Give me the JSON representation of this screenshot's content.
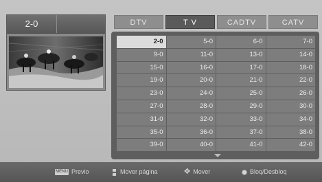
{
  "current_channel": "2-0",
  "tabs": [
    {
      "label": "DTV",
      "active": false
    },
    {
      "label": "T V",
      "active": true
    },
    {
      "label": "CADTV",
      "active": false
    },
    {
      "label": "CATV",
      "active": false
    }
  ],
  "channels": [
    [
      "2-0",
      "5-0",
      "6-0",
      "7-0"
    ],
    [
      "9-0",
      "11-0",
      "13-0",
      "14-0"
    ],
    [
      "15-0",
      "16-0",
      "17-0",
      "18-0"
    ],
    [
      "19-0",
      "20-0",
      "21-0",
      "22-0"
    ],
    [
      "23-0",
      "24-0",
      "25-0",
      "26-0"
    ],
    [
      "27-0",
      "28-0",
      "29-0",
      "30-0"
    ],
    [
      "31-0",
      "32-0",
      "33-0",
      "34-0"
    ],
    [
      "35-0",
      "36-0",
      "37-0",
      "38-0"
    ],
    [
      "39-0",
      "40-0",
      "41-0",
      "42-0"
    ]
  ],
  "selected_channel": "2-0",
  "bottom_bar": {
    "menu_key": "MENU",
    "prev_label": "Previo",
    "page_label": "Mover página",
    "move_label": "Mover",
    "lock_label": "Bloq/Desbloq"
  },
  "icons": {
    "page": "page-updown-icon",
    "move": "four-way-arrow-icon",
    "ok": "ok-button-icon"
  }
}
